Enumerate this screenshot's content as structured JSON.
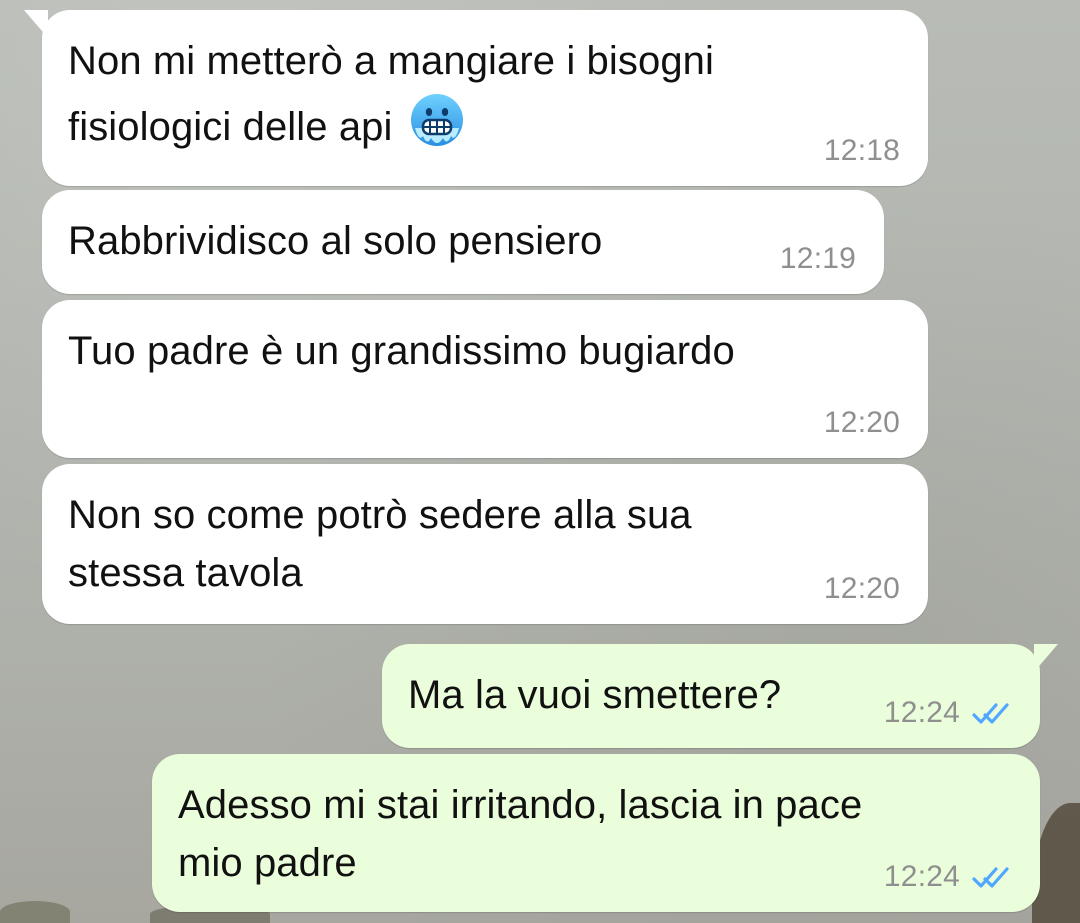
{
  "messages": [
    {
      "side": "incoming",
      "text": "Non mi metterò a mangiare i bisogni\nfisiologici delle api",
      "emoji": "cold-face",
      "time": "12:18"
    },
    {
      "side": "incoming",
      "text": "Rabbrividisco al solo pensiero",
      "time": "12:19"
    },
    {
      "side": "incoming",
      "text": "Tuo padre è un grandissimo bugiardo",
      "time": "12:20"
    },
    {
      "side": "incoming",
      "text": "Non so come potrò sedere alla sua\nstessa tavola",
      "time": "12:20"
    },
    {
      "side": "outgoing",
      "text": "Ma la vuoi smettere?",
      "time": "12:24",
      "status": "read"
    },
    {
      "side": "outgoing",
      "text": "Adesso mi stai irritando, lascia in pace\nmio padre",
      "time": "12:24",
      "status": "read"
    }
  ],
  "colors": {
    "incoming_bubble": "#ffffff",
    "outgoing_bubble": "#ebfedb",
    "timestamp": "#8f8f8f",
    "read_ticks": "#4fa7ff"
  }
}
